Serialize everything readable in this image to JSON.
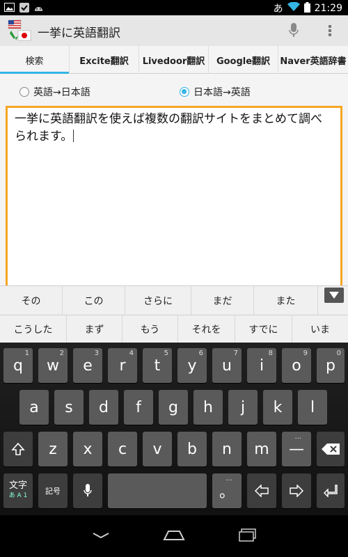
{
  "status": {
    "ime": "あ",
    "time": "21:29"
  },
  "app": {
    "title": "一挙に英語翻訳"
  },
  "tabs": [
    {
      "label": "検索",
      "active": true
    },
    {
      "label": "Excite翻訳"
    },
    {
      "label": "Livedoor翻訳"
    },
    {
      "label": "Google翻訳"
    },
    {
      "label": "Naver英語辞書"
    }
  ],
  "direction": {
    "en_to_ja": "英語→日本語",
    "ja_to_en": "日本語→英語",
    "selected": "ja_to_en"
  },
  "editor": {
    "text": "一挙に英語翻訳を使えば複数の翻訳サイトをまとめて調べられます。"
  },
  "candidates": {
    "row1": [
      "その",
      "この",
      "さらに",
      "まだ",
      "また"
    ],
    "row2": [
      "こうした",
      "まず",
      "もう",
      "それを",
      "すでに",
      "いま"
    ]
  },
  "keyboard": {
    "row1": [
      {
        "key": "q",
        "hint": "1"
      },
      {
        "key": "w",
        "hint": "2"
      },
      {
        "key": "e",
        "hint": "3"
      },
      {
        "key": "r",
        "hint": "4"
      },
      {
        "key": "t",
        "hint": "5"
      },
      {
        "key": "y",
        "hint": "6"
      },
      {
        "key": "u",
        "hint": "7"
      },
      {
        "key": "i",
        "hint": "8"
      },
      {
        "key": "o",
        "hint": "9"
      },
      {
        "key": "p",
        "hint": "0"
      }
    ],
    "row2": [
      "a",
      "s",
      "d",
      "f",
      "g",
      "h",
      "j",
      "k",
      "l"
    ],
    "row3": [
      "z",
      "x",
      "c",
      "v",
      "b",
      "n",
      "m"
    ],
    "dash": "—",
    "dash_hint": "...",
    "mode_label": "文字",
    "mode_sub": "あ A 1",
    "symbol_label": "記号",
    "period": "。",
    "period_hint": "..."
  }
}
